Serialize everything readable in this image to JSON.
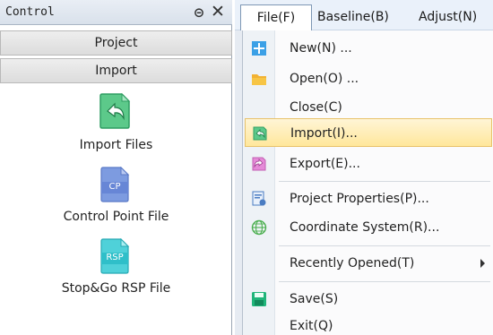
{
  "control_panel": {
    "title": "Control",
    "sections": {
      "project": "Project",
      "import": "Import"
    },
    "tools": [
      {
        "label": "Import Files",
        "icon": "import-arrow-icon"
      },
      {
        "label": "Control Point File",
        "icon_text": "CP",
        "icon": "control-point-file-icon"
      },
      {
        "label": "Stop&Go RSP File",
        "icon_text": "RSP",
        "icon": "rsp-file-icon"
      }
    ]
  },
  "menubar": {
    "file": "File(F)",
    "baseline": "Baseline(B)",
    "adjust": "Adjust(N)"
  },
  "file_menu": {
    "items": [
      {
        "label": "New(N) ...",
        "icon": "new-file-icon"
      },
      {
        "label": "Open(O) ...",
        "icon": "folder-open-icon"
      },
      {
        "label": "Close(C)"
      },
      {
        "label": "Import(I)...",
        "icon": "import-icon",
        "highlighted": true
      },
      {
        "label": "Export(E)...",
        "icon": "export-icon"
      },
      {
        "label": "Project Properties(P)...",
        "icon": "project-properties-icon"
      },
      {
        "label": "Coordinate System(R)...",
        "icon": "globe-icon"
      },
      {
        "label": "Recently Opened(T)",
        "has_submenu": true
      },
      {
        "label": "Save(S)",
        "icon": "save-icon"
      },
      {
        "label": "Exit(Q)"
      }
    ]
  },
  "colors": {
    "highlight": "#ffe79b",
    "accent_green": "#3cb371",
    "accent_blue": "#7d9be0",
    "accent_cyan": "#4fd1d9"
  }
}
